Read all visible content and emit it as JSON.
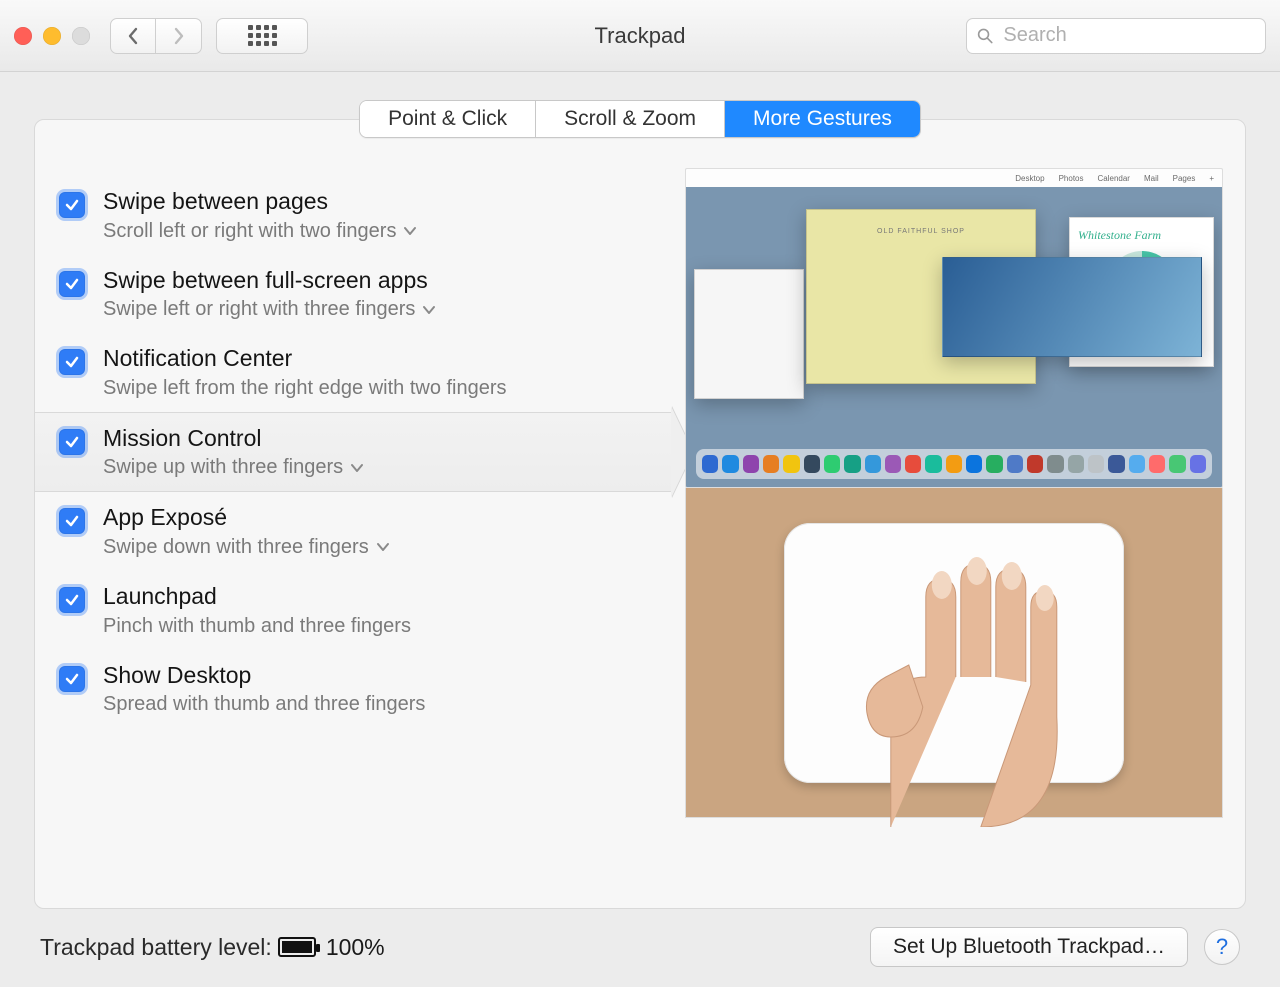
{
  "window": {
    "title": "Trackpad"
  },
  "search": {
    "placeholder": "Search"
  },
  "tabs": [
    {
      "label": "Point & Click",
      "active": false
    },
    {
      "label": "Scroll & Zoom",
      "active": false
    },
    {
      "label": "More Gestures",
      "active": true
    }
  ],
  "gestures": [
    {
      "id": "swipe-pages",
      "title": "Swipe between pages",
      "desc": "Scroll left or right with two fingers",
      "checked": true,
      "hasDropdown": true,
      "selected": false
    },
    {
      "id": "swipe-fullscreen",
      "title": "Swipe between full-screen apps",
      "desc": "Swipe left or right with three fingers",
      "checked": true,
      "hasDropdown": true,
      "selected": false
    },
    {
      "id": "notification-center",
      "title": "Notification Center",
      "desc": "Swipe left from the right edge with two fingers",
      "checked": true,
      "hasDropdown": false,
      "selected": false
    },
    {
      "id": "mission-control",
      "title": "Mission Control",
      "desc": "Swipe up with three fingers",
      "checked": true,
      "hasDropdown": true,
      "selected": true
    },
    {
      "id": "app-expose",
      "title": "App Exposé",
      "desc": "Swipe down with three fingers",
      "checked": true,
      "hasDropdown": true,
      "selected": false
    },
    {
      "id": "launchpad",
      "title": "Launchpad",
      "desc": "Pinch with thumb and three fingers",
      "checked": true,
      "hasDropdown": false,
      "selected": false
    },
    {
      "id": "show-desktop",
      "title": "Show Desktop",
      "desc": "Spread with thumb and three fingers",
      "checked": true,
      "hasDropdown": false,
      "selected": false
    }
  ],
  "preview": {
    "menubar": [
      "Desktop",
      "Photos",
      "Calendar",
      "Mail",
      "Pages"
    ],
    "whitestone_label": "Whitestone Farm",
    "dock_colors": [
      "#2e6ad1",
      "#1f8ae0",
      "#8e44ad",
      "#e67e22",
      "#f1c40f",
      "#34495e",
      "#2ecc71",
      "#16a085",
      "#3498db",
      "#9b59b6",
      "#e74c3c",
      "#1abc9c",
      "#f39c12",
      "#0b74de",
      "#27ae60",
      "#4f7ac7",
      "#c0392b",
      "#7f8c8d",
      "#95a5a6",
      "#bdc3c7",
      "#3b5998",
      "#55acee",
      "#ff6b6b",
      "#48c774",
      "#6772e5"
    ]
  },
  "footer": {
    "battery_label": "Trackpad battery level:",
    "battery_pct": "100%",
    "setup_button": "Set Up Bluetooth Trackpad…"
  }
}
